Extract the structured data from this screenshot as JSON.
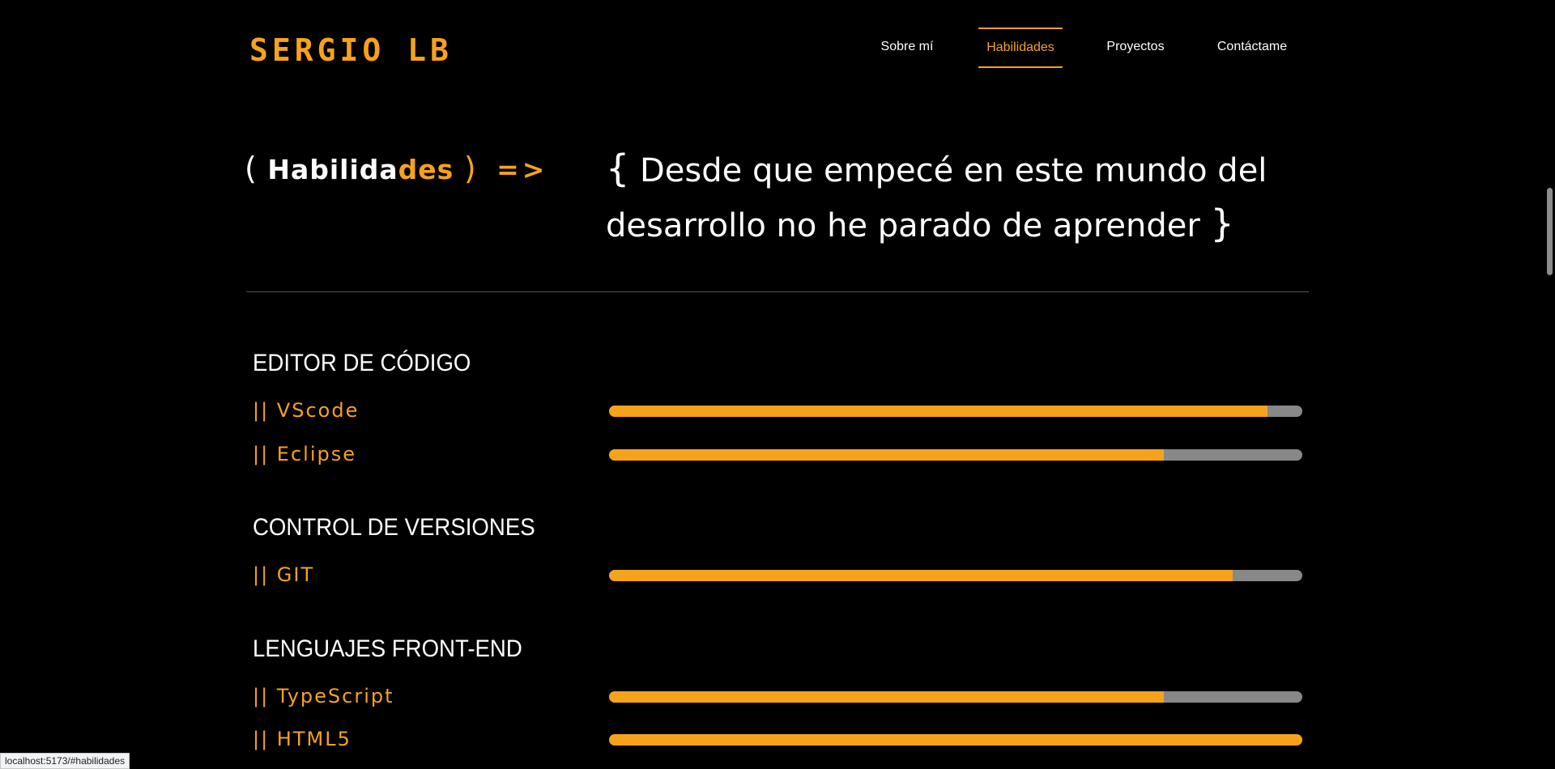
{
  "header": {
    "logo": "SERGIO LB",
    "nav": [
      {
        "label": "Sobre mí",
        "active": false
      },
      {
        "label": "Habilidades",
        "active": true
      },
      {
        "label": "Proyectos",
        "active": false
      },
      {
        "label": "Contáctame",
        "active": false
      }
    ]
  },
  "intro": {
    "label_open": "(",
    "label_word_white": "Habilida",
    "label_word_orange": "des",
    "label_close": ")",
    "label_arrow": "=>",
    "tagline_open": "{",
    "tagline_text": "Desde que empecé en este mundo del desarrollo no he parado de aprender",
    "tagline_close": "}"
  },
  "skills": [
    {
      "category": "EDITOR DE CÓDIGO",
      "items": [
        {
          "name": "|| VScode",
          "level": 0.95
        },
        {
          "name": "|| Eclipse",
          "level": 0.8
        }
      ]
    },
    {
      "category": "CONTROL DE VERSIONES",
      "items": [
        {
          "name": "|| GIT",
          "level": 0.9
        }
      ]
    },
    {
      "category": "LENGUAJES FRONT-END",
      "items": [
        {
          "name": "|| TypeScript",
          "level": 0.8
        },
        {
          "name": "|| HTML5",
          "level": 1.0
        }
      ]
    }
  ],
  "status_bar": {
    "url": "localhost:5173/#habilidades"
  },
  "colors": {
    "accent": "#f7a21b",
    "background": "#000000",
    "track": "#888888"
  }
}
